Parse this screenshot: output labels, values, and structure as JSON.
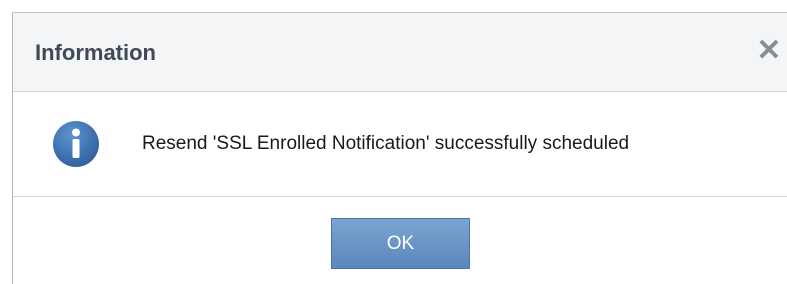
{
  "dialog": {
    "title": "Information",
    "close_glyph": "✕",
    "close_icon": "close-icon",
    "icon": "info-icon",
    "icon_color": "#3a6fb0",
    "message": "Resend 'SSL Enrolled Notification' successfully scheduled",
    "ok_label": "OK",
    "button_color": "#6b97c8"
  }
}
